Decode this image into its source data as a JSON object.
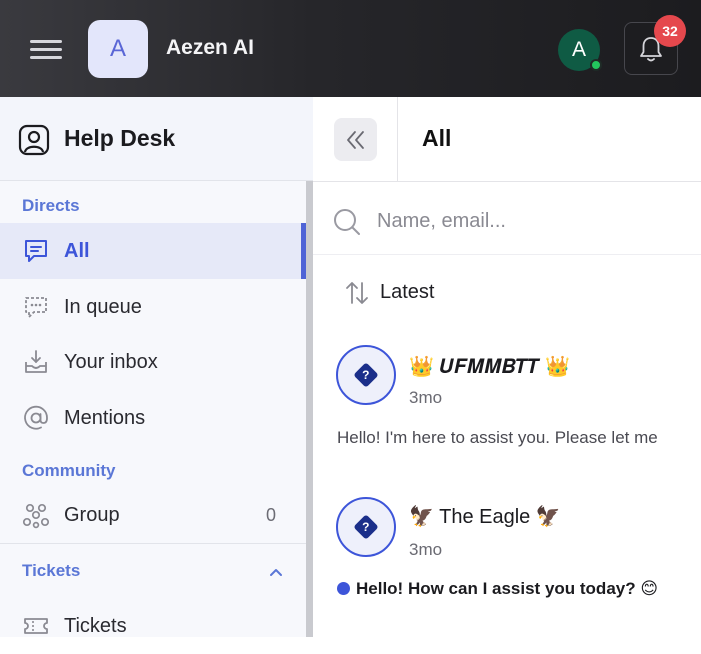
{
  "topbar": {
    "brand_initial": "A",
    "brand_name": "Aezen AI",
    "user_initial": "A",
    "notification_count": "32"
  },
  "sidebar": {
    "title": "Help Desk",
    "sections": {
      "directs": "Directs",
      "community": "Community",
      "tickets": "Tickets"
    },
    "items": {
      "all": "All",
      "in_queue": "In queue",
      "your_inbox": "Your inbox",
      "mentions": "Mentions",
      "group": "Group",
      "group_count": "0",
      "tickets": "Tickets"
    }
  },
  "main": {
    "title": "All",
    "search_placeholder": "Name, email...",
    "sort_label": "Latest",
    "conversations": [
      {
        "avatar_glyph": "?",
        "name": "👑 𝑼𝑭𝑴𝑴𝑩𝑻𝑻 👑",
        "time": "3mo",
        "message": "Hello! I'm here to assist you. Please let me",
        "unread": false
      },
      {
        "avatar_glyph": "?",
        "name": "🦅 The Eagle 🦅",
        "time": "3mo",
        "message": "Hello! How can I assist you today? 😊",
        "unread": true
      }
    ]
  },
  "colors": {
    "accent": "#3d55d9",
    "section_label": "#5b77d6",
    "badge": "#e5484d",
    "online": "#23c55e"
  }
}
